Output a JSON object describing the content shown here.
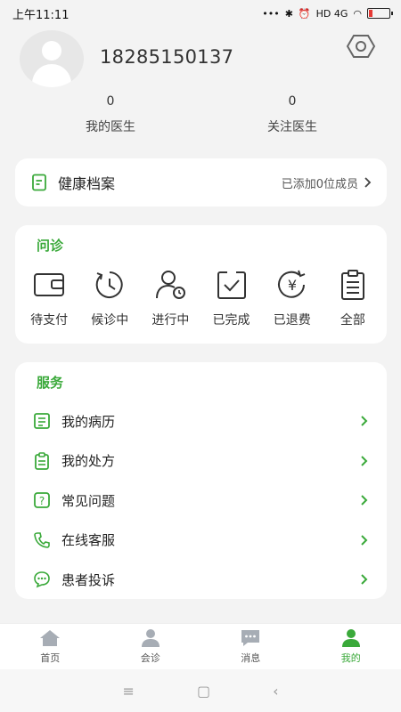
{
  "status": {
    "time": "上午11:11",
    "network": "HD 4G"
  },
  "profile": {
    "phone": "18285150137"
  },
  "stats": [
    {
      "value": "0",
      "label": "我的医生"
    },
    {
      "value": "0",
      "label": "关注医生"
    }
  ],
  "health": {
    "title": "健康档案",
    "hint": "已添加0位成员"
  },
  "consult": {
    "title": "问诊",
    "items": [
      {
        "label": "待支付",
        "icon": "wallet-icon"
      },
      {
        "label": "候诊中",
        "icon": "clock-icon"
      },
      {
        "label": "进行中",
        "icon": "user-clock-icon"
      },
      {
        "label": "已完成",
        "icon": "check-box-icon"
      },
      {
        "label": "已退费",
        "icon": "refund-icon"
      },
      {
        "label": "全部",
        "icon": "clipboard-icon"
      }
    ]
  },
  "service": {
    "title": "服务",
    "items": [
      {
        "label": "我的病历",
        "icon": "medical-record-icon"
      },
      {
        "label": "我的处方",
        "icon": "prescription-icon"
      },
      {
        "label": "常见问题",
        "icon": "question-icon"
      },
      {
        "label": "在线客服",
        "icon": "phone-icon"
      },
      {
        "label": "患者投诉",
        "icon": "chat-icon"
      }
    ]
  },
  "tabs": [
    {
      "label": "首页",
      "icon": "home-icon"
    },
    {
      "label": "会诊",
      "icon": "consult-icon"
    },
    {
      "label": "消息",
      "icon": "message-icon"
    },
    {
      "label": "我的",
      "icon": "profile-icon"
    }
  ],
  "colors": {
    "accent": "#3aa93a",
    "background": "#f3f3f3",
    "tab_inactive": "#a7adb5"
  }
}
